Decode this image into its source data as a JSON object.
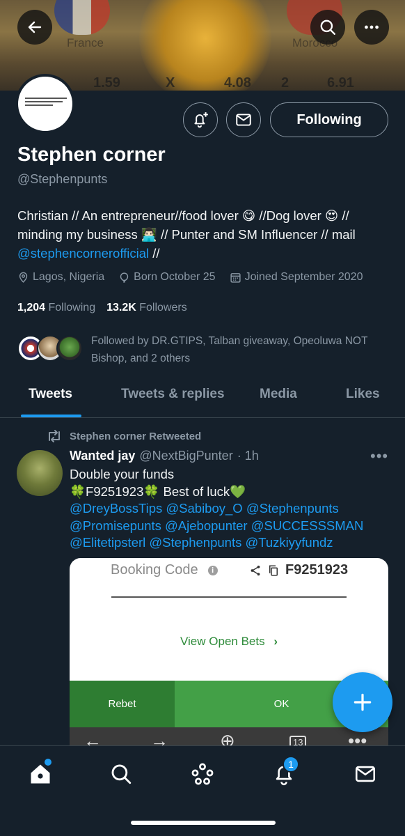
{
  "banner": {
    "left_team": "France",
    "right_team": "Morocco",
    "odds": [
      "1.59",
      "X",
      "4.08",
      "2",
      "6.91"
    ]
  },
  "header_icons": {
    "back": "arrow-left-icon",
    "search": "search-icon",
    "more": "more-icon"
  },
  "profile": {
    "name": "Stephen corner",
    "handle": "@Stephenpunts",
    "follow_label": "Following",
    "bio_line1": "Christian // An entrepreneur//food lover 😋 //Dog lover 😍 //",
    "bio_line2": "minding my business 👨🏻‍💻 // Punter and SM Influencer // mail",
    "bio_link": "@stephencornerofficial",
    "bio_tail": " //",
    "location": "Lagos, Nigeria",
    "born": "Born October 25",
    "joined": "Joined September 2020",
    "following_count": "1,204",
    "following_label": "Following",
    "followers_count": "13.2K",
    "followers_label": "Followers",
    "followed_by": "Followed by DR.GTIPS, Talban giveaway, Opeoluwa NOT Bishop, and 2 others"
  },
  "tabs": [
    "Tweets",
    "Tweets & replies",
    "Media",
    "Likes"
  ],
  "tweet": {
    "retweet_label": "Stephen corner Retweeted",
    "display_name": "Wanted jay",
    "username": "@NextBigPunter",
    "time": "· 1h",
    "line1": "Double your funds",
    "line2": "🍀F9251923🍀 Best of luck💚",
    "mentions": "@DreyBossTips @Sabiboy_O @Stephenpunts @Promisepunts @Ajebopunter @SUCCESSSMAN @Elitetipsterl @Stephenpunts @Tuzkiyyfundz"
  },
  "media": {
    "booking_label": "Booking Code",
    "booking_code": "F9251923",
    "open_bets": "View Open Bets",
    "rebet": "Rebet",
    "ok": "OK",
    "tab_count": "13"
  },
  "bottom_nav": {
    "items": [
      "home-icon",
      "search-icon",
      "spaces-icon",
      "notifications-icon",
      "messages-icon"
    ],
    "notification_badge": "1"
  },
  "colors": {
    "background": "#15202b",
    "accent": "#1d9bf0",
    "muted": "#8b98a5"
  }
}
